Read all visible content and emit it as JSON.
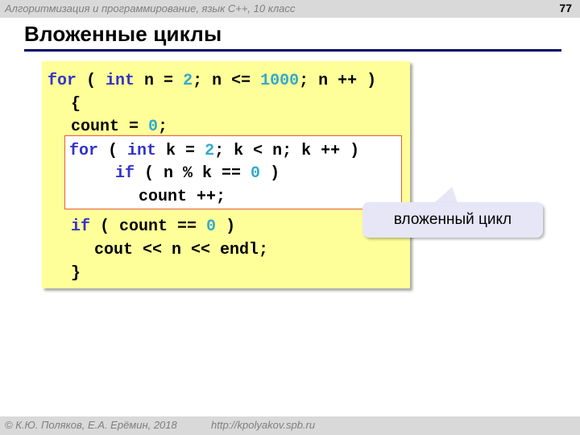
{
  "header": {
    "course": "Алгоритмизация и программирование, язык C++, 10 класс",
    "page_number": "77"
  },
  "slide": {
    "title": "Вложенные циклы"
  },
  "code": {
    "line1": {
      "kw_for": "for",
      "p1": " ( ",
      "kw_int": "int",
      "p2": " n = ",
      "n1": "2",
      "p3": "; n <= ",
      "n2": "1000",
      "p4": "; n ++ )"
    },
    "line2": {
      "text": "{"
    },
    "line3": {
      "p1": "count = ",
      "n1": "0",
      "p2": ";"
    },
    "line4": {
      "kw_for": "for",
      "p1": " ( ",
      "kw_int": "int",
      "p2": " k = ",
      "n1": "2",
      "p3": "; k < n; k ++ )"
    },
    "line5": {
      "kw_if": "if",
      "p1": " ( n % k == ",
      "n1": "0",
      "p2": " )"
    },
    "line6": {
      "text": "count ++;"
    },
    "line7": {
      "kw_if": "if",
      "p1": " ( count == ",
      "n1": "0",
      "p2": " )"
    },
    "line8": {
      "text": "cout << n << endl;"
    },
    "line9": {
      "text": "}"
    }
  },
  "callout": {
    "text": "вложенный цикл"
  },
  "footer": {
    "copyright": "© К.Ю. Поляков, Е.А. Ерёмин, 2018",
    "url": "http://kpolyakov.spb.ru"
  },
  "colors": {
    "keyword": "#3333cc",
    "number": "#33aacc",
    "code_bg": "#ffff99",
    "nested_border": "#e0603a",
    "title_rule": "#000066",
    "callout_bg": "#e6e6f7"
  }
}
